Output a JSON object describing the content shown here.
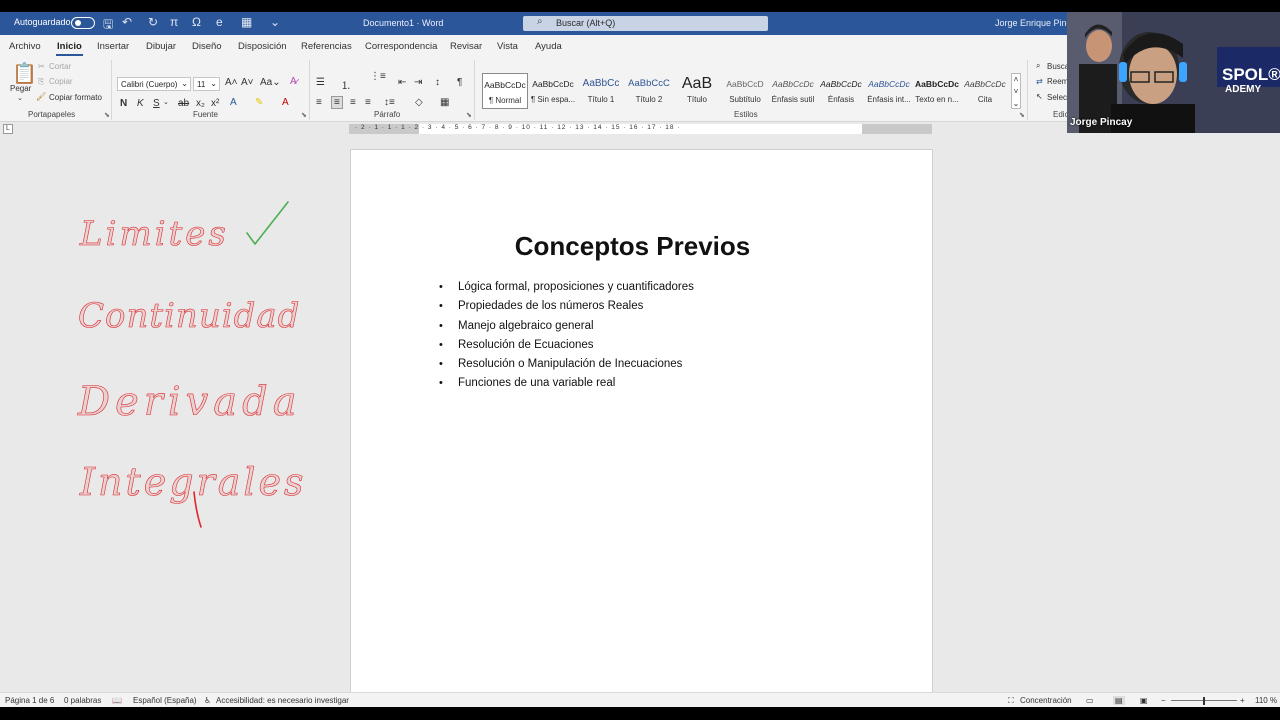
{
  "titlebar": {
    "autosave_label": "Autoguardado",
    "doc_title": "Documento1 · Word",
    "search_placeholder": "Buscar (Alt+Q)",
    "user_name": "Jorge Enrique Pincay"
  },
  "menu": {
    "tabs": [
      "Archivo",
      "Inicio",
      "Insertar",
      "Dibujar",
      "Diseño",
      "Disposición",
      "Referencias",
      "Correspondencia",
      "Revisar",
      "Vista",
      "Ayuda"
    ],
    "active": "Inicio"
  },
  "ribbon": {
    "clipboard": {
      "paste": "Pegar",
      "cut": "Cortar",
      "copy": "Copiar",
      "format_painter": "Copiar formato",
      "label": "Portapapeles"
    },
    "font": {
      "family": "Calibri (Cuerpo)",
      "size": "11",
      "bold": "N",
      "italic": "K",
      "underline": "S",
      "label": "Fuente"
    },
    "paragraph": {
      "label": "Párrafo"
    },
    "styles": {
      "label": "Estilos",
      "items": [
        {
          "preview": "AaBbCcDc",
          "name": "¶ Normal"
        },
        {
          "preview": "AaBbCcDc",
          "name": "¶ Sin espa..."
        },
        {
          "preview": "AaBbCc",
          "name": "Título 1"
        },
        {
          "preview": "AaBbCcC",
          "name": "Título 2"
        },
        {
          "preview": "AaB",
          "name": "Título"
        },
        {
          "preview": "AaBbCcD",
          "name": "Subtítulo"
        },
        {
          "preview": "AaBbCcDc",
          "name": "Énfasis sutil"
        },
        {
          "preview": "AaBbCcDc",
          "name": "Énfasis"
        },
        {
          "preview": "AaBbCcDc",
          "name": "Énfasis int..."
        },
        {
          "preview": "AaBbCcDc",
          "name": "Texto en n..."
        },
        {
          "preview": "AaBbCcDc",
          "name": "Cita"
        }
      ]
    },
    "editing": {
      "find": "Buscar",
      "replace": "Reemplazar",
      "select": "Seleccionar",
      "label": "Edición"
    }
  },
  "ruler": {
    "ticks": "· 2 · 1 · 1 · 1 · 2 · 3 · 4 · 5 · 6 · 7 · 8 · 9 · 10 · 11 · 12 · 13 · 14 · 15 · 16 · 17 · 18 ·"
  },
  "document": {
    "heading": "Conceptos Previos",
    "bullets": [
      "Lógica formal, proposiciones y cuantificadores",
      "Propiedades de los números Reales",
      "Manejo algebraico general",
      "Resolución de Ecuaciones",
      "Resolución o Manipulación de Inecuaciones",
      "Funciones de una variable real"
    ]
  },
  "annotations": {
    "words": [
      "Limites",
      "Continuidad",
      "Derivada",
      "Integrales"
    ],
    "ink_color": "#e0262b",
    "check_color": "#4caf50"
  },
  "statusbar": {
    "page": "Página 1 de 6",
    "words": "0 palabras",
    "language": "Español (España)",
    "accessibility": "Accesibilidad: es necesario investigar",
    "focus": "Concentración",
    "zoom": "110 %"
  },
  "webcam": {
    "name": "Jorge Pincay",
    "brand_text_top": "SPOL®",
    "brand_text_bottom": "ADEMY"
  },
  "colors": {
    "word_blue": "#2b579a",
    "ribbon_bg": "#f3f3f3",
    "canvas_bg": "#e9e9e9"
  }
}
